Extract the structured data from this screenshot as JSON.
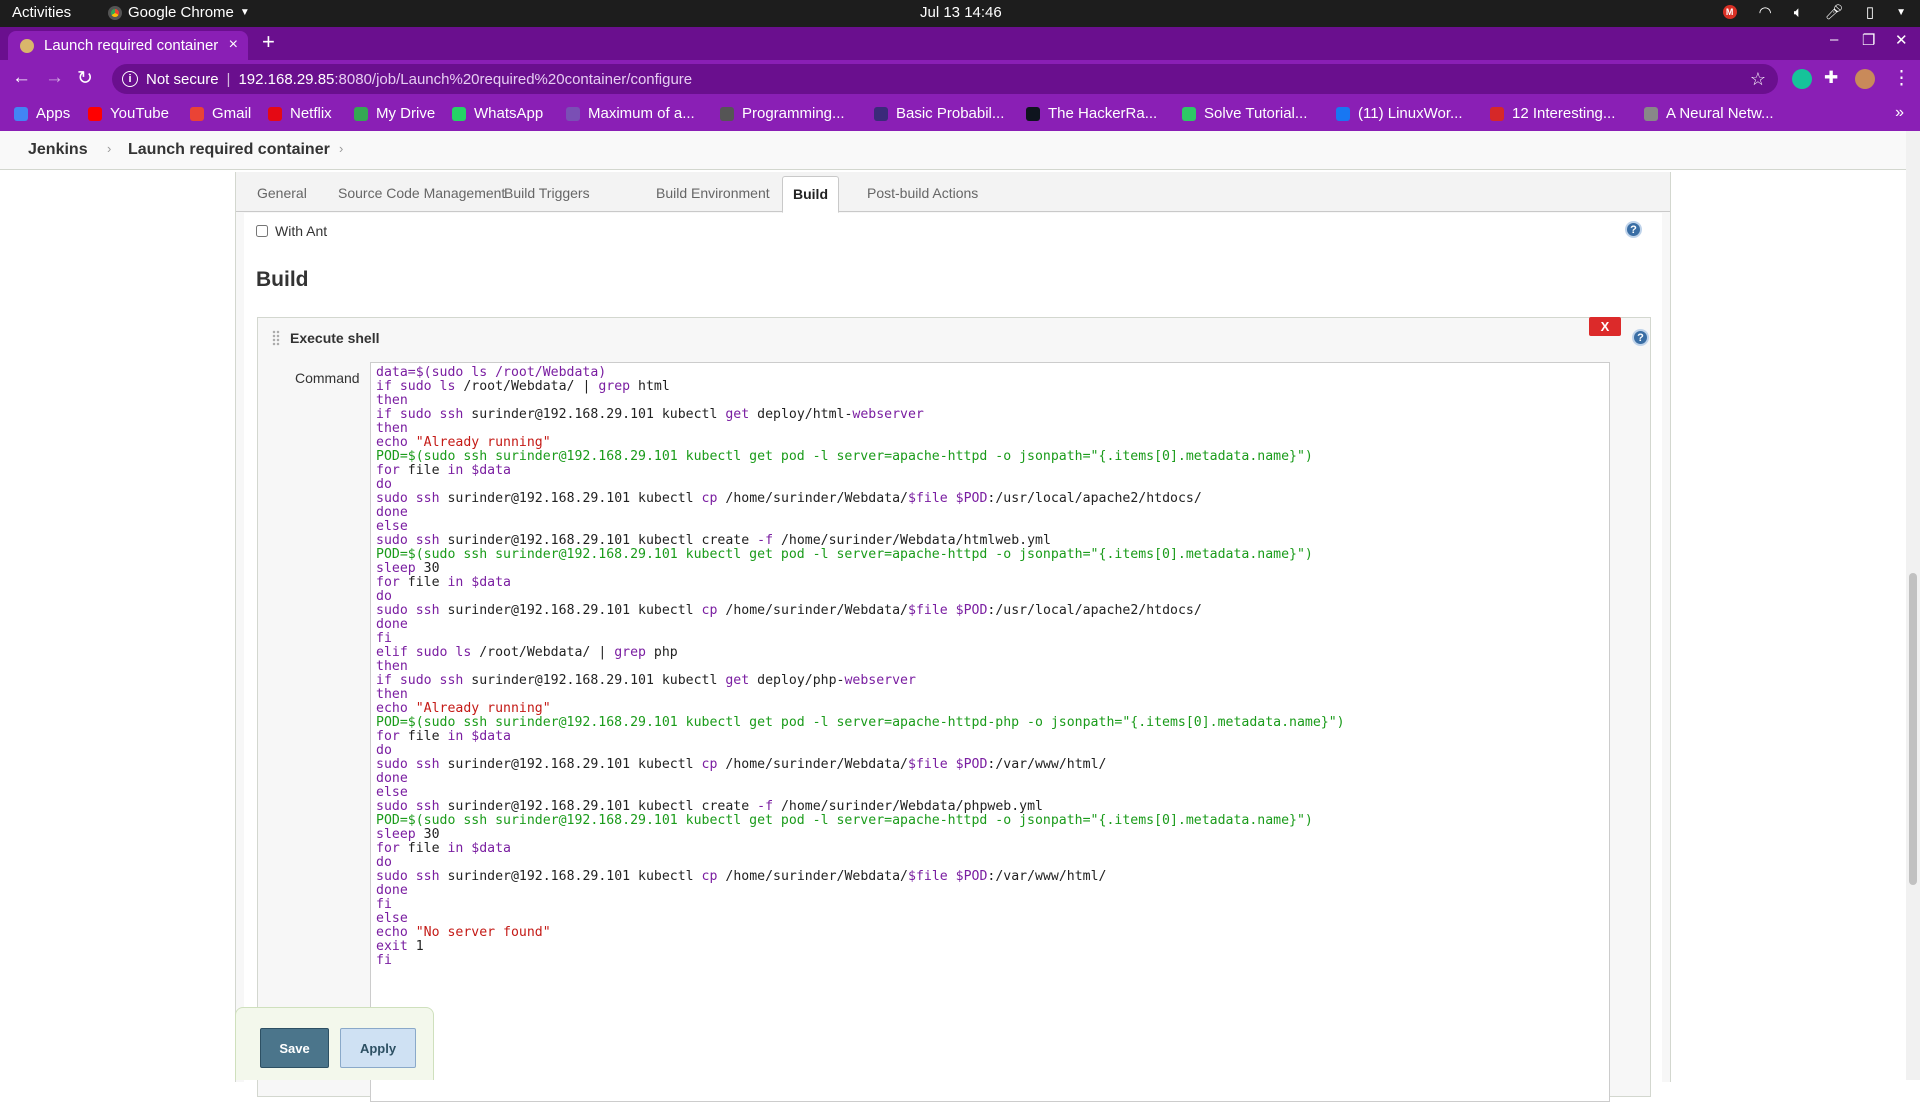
{
  "gnome": {
    "activities": "Activities",
    "app_name": "Google Chrome",
    "clock": "Jul 13  14:46"
  },
  "browser": {
    "tab_title": "Launch required container",
    "tab_close": "×",
    "new_tab": "+",
    "security": "Not secure",
    "url_host": "192.168.29.85",
    "url_path": ":8080/job/Launch%20required%20container/configure"
  },
  "bookmarks": [
    {
      "label": "Apps",
      "color": "#4285f4"
    },
    {
      "label": "YouTube",
      "color": "#ff0000"
    },
    {
      "label": "Gmail",
      "color": "#ea4335"
    },
    {
      "label": "Netflix",
      "color": "#e50914"
    },
    {
      "label": "My Drive",
      "color": "#34a853"
    },
    {
      "label": "WhatsApp",
      "color": "#25d366"
    },
    {
      "label": "Maximum of a...",
      "color": "#7a4fb5"
    },
    {
      "label": "Programming...",
      "color": "#555555"
    },
    {
      "label": "Basic Probabil...",
      "color": "#3b2a7a"
    },
    {
      "label": "The HackerRa...",
      "color": "#0e141e"
    },
    {
      "label": "Solve Tutorial...",
      "color": "#2ec866"
    },
    {
      "label": "(11) LinuxWor...",
      "color": "#1877f2"
    },
    {
      "label": "12 Interesting...",
      "color": "#d62828"
    },
    {
      "label": "A Neural Netw...",
      "color": "#888888"
    }
  ],
  "breadcrumb": {
    "root": "Jenkins",
    "job": "Launch required container"
  },
  "config_tabs": [
    "General",
    "Source Code Management",
    "Build Triggers",
    "Build Environment",
    "Build",
    "Post-build Actions"
  ],
  "active_tab": "Build",
  "with_ant_label": "With Ant",
  "help_glyph": "?",
  "section_title": "Build",
  "builder": {
    "title": "Execute shell",
    "delete_label": "X",
    "command_label": "Command"
  },
  "command_lines": [
    [
      [
        "data=$(sudo ls /root/Webdata)",
        "#7a1ea1"
      ]
    ],
    [
      [
        "if sudo ls",
        "#7a1ea1"
      ],
      [
        " /root/Webdata/ | ",
        "#222222"
      ],
      [
        "grep",
        "#7a1ea1"
      ],
      [
        " html",
        "#222222"
      ]
    ],
    [
      [
        "then",
        "#7a1ea1"
      ]
    ],
    [
      [
        "if sudo ssh",
        "#7a1ea1"
      ],
      [
        " surinder@192.168.29.101 kubectl ",
        "#222222"
      ],
      [
        "get",
        "#7a1ea1"
      ],
      [
        " deploy/html-",
        "#222222"
      ],
      [
        "webserver",
        "#7a1ea1"
      ]
    ],
    [
      [
        "then",
        "#7a1ea1"
      ]
    ],
    [
      [
        "echo",
        "#7a1ea1"
      ],
      [
        " \"Already running\"",
        "#c41a16"
      ]
    ],
    [
      [
        "POD=$(sudo ssh surinder@192.168.29.101 kubectl get pod -l server=apache-httpd -o jsonpath=\"{.items[0].metadata.name}\")",
        "#1a9b1a"
      ]
    ],
    [
      [
        "for",
        "#7a1ea1"
      ],
      [
        " file ",
        "#222222"
      ],
      [
        "in $data",
        "#7a1ea1"
      ]
    ],
    [
      [
        "do",
        "#7a1ea1"
      ]
    ],
    [
      [
        "sudo ssh",
        "#7a1ea1"
      ],
      [
        " surinder@192.168.29.101 kubectl ",
        "#222222"
      ],
      [
        "cp",
        "#7a1ea1"
      ],
      [
        " /home/surinder/Webdata/",
        "#222222"
      ],
      [
        "$file $POD",
        "#7a1ea1"
      ],
      [
        ":/usr/local/apache2/htdocs/",
        "#222222"
      ]
    ],
    [
      [
        "done",
        "#7a1ea1"
      ]
    ],
    [
      [
        "else",
        "#7a1ea1"
      ]
    ],
    [
      [
        "sudo ssh",
        "#7a1ea1"
      ],
      [
        " surinder@192.168.29.101 kubectl create ",
        "#222222"
      ],
      [
        "-f",
        "#7a1ea1"
      ],
      [
        " /home/surinder/Webdata/htmlweb.yml",
        "#222222"
      ]
    ],
    [
      [
        "POD=$(sudo ssh surinder@192.168.29.101 kubectl get pod -l server=apache-httpd -o jsonpath=\"{.items[0].metadata.name}\")",
        "#1a9b1a"
      ]
    ],
    [
      [
        "sleep",
        "#7a1ea1"
      ],
      [
        " 30",
        "#222222"
      ]
    ],
    [
      [
        "for",
        "#7a1ea1"
      ],
      [
        " file ",
        "#222222"
      ],
      [
        "in $data",
        "#7a1ea1"
      ]
    ],
    [
      [
        "do",
        "#7a1ea1"
      ]
    ],
    [
      [
        "sudo ssh",
        "#7a1ea1"
      ],
      [
        " surinder@192.168.29.101 kubectl ",
        "#222222"
      ],
      [
        "cp",
        "#7a1ea1"
      ],
      [
        " /home/surinder/Webdata/",
        "#222222"
      ],
      [
        "$file $POD",
        "#7a1ea1"
      ],
      [
        ":/usr/local/apache2/htdocs/",
        "#222222"
      ]
    ],
    [
      [
        "done",
        "#7a1ea1"
      ]
    ],
    [
      [
        "fi",
        "#7a1ea1"
      ]
    ],
    [
      [
        "elif sudo ls",
        "#7a1ea1"
      ],
      [
        " /root/Webdata/ | ",
        "#222222"
      ],
      [
        "grep",
        "#7a1ea1"
      ],
      [
        " php",
        "#222222"
      ]
    ],
    [
      [
        "then",
        "#7a1ea1"
      ]
    ],
    [
      [
        "if sudo ssh",
        "#7a1ea1"
      ],
      [
        " surinder@192.168.29.101 kubectl ",
        "#222222"
      ],
      [
        "get",
        "#7a1ea1"
      ],
      [
        " deploy/php-",
        "#222222"
      ],
      [
        "webserver",
        "#7a1ea1"
      ]
    ],
    [
      [
        "then",
        "#7a1ea1"
      ]
    ],
    [
      [
        "echo",
        "#7a1ea1"
      ],
      [
        " \"Already running\"",
        "#c41a16"
      ]
    ],
    [
      [
        "POD=$(sudo ssh surinder@192.168.29.101 kubectl get pod -l server=apache-httpd-php -o jsonpath=\"{.items[0].metadata.name}\")",
        "#1a9b1a"
      ]
    ],
    [
      [
        "for",
        "#7a1ea1"
      ],
      [
        " file ",
        "#222222"
      ],
      [
        "in $data",
        "#7a1ea1"
      ]
    ],
    [
      [
        "do",
        "#7a1ea1"
      ]
    ],
    [
      [
        "sudo ssh",
        "#7a1ea1"
      ],
      [
        " surinder@192.168.29.101 kubectl ",
        "#222222"
      ],
      [
        "cp",
        "#7a1ea1"
      ],
      [
        " /home/surinder/Webdata/",
        "#222222"
      ],
      [
        "$file $POD",
        "#7a1ea1"
      ],
      [
        ":/var/www/html/",
        "#222222"
      ]
    ],
    [
      [
        "done",
        "#7a1ea1"
      ]
    ],
    [
      [
        "else",
        "#7a1ea1"
      ]
    ],
    [
      [
        "sudo ssh",
        "#7a1ea1"
      ],
      [
        " surinder@192.168.29.101 kubectl create ",
        "#222222"
      ],
      [
        "-f",
        "#7a1ea1"
      ],
      [
        " /home/surinder/Webdata/phpweb.yml",
        "#222222"
      ]
    ],
    [
      [
        "POD=$(sudo ssh surinder@192.168.29.101 kubectl get pod -l server=apache-httpd -o jsonpath=\"{.items[0].metadata.name}\")",
        "#1a9b1a"
      ]
    ],
    [
      [
        "sleep",
        "#7a1ea1"
      ],
      [
        " 30",
        "#222222"
      ]
    ],
    [
      [
        "for",
        "#7a1ea1"
      ],
      [
        " file ",
        "#222222"
      ],
      [
        "in $data",
        "#7a1ea1"
      ]
    ],
    [
      [
        "do",
        "#7a1ea1"
      ]
    ],
    [
      [
        "sudo ssh",
        "#7a1ea1"
      ],
      [
        " surinder@192.168.29.101 kubectl ",
        "#222222"
      ],
      [
        "cp",
        "#7a1ea1"
      ],
      [
        " /home/surinder/Webdata/",
        "#222222"
      ],
      [
        "$file $POD",
        "#7a1ea1"
      ],
      [
        ":/var/www/html/",
        "#222222"
      ]
    ],
    [
      [
        "done",
        "#7a1ea1"
      ]
    ],
    [
      [
        "fi",
        "#7a1ea1"
      ]
    ],
    [
      [
        "else",
        "#7a1ea1"
      ]
    ],
    [
      [
        "echo",
        "#7a1ea1"
      ],
      [
        " \"No server found\"",
        "#c41a16"
      ]
    ],
    [
      [
        "exit",
        "#7a1ea1"
      ],
      [
        " 1",
        "#222222"
      ]
    ],
    [
      [
        "fi",
        "#7a1ea1"
      ]
    ]
  ],
  "buttons": {
    "save": "Save",
    "apply": "Apply"
  },
  "colors": {
    "browser_accent": "#8a1fb5",
    "jenkins_save": "#4b758b",
    "delete_red": "#dc2a2a"
  }
}
